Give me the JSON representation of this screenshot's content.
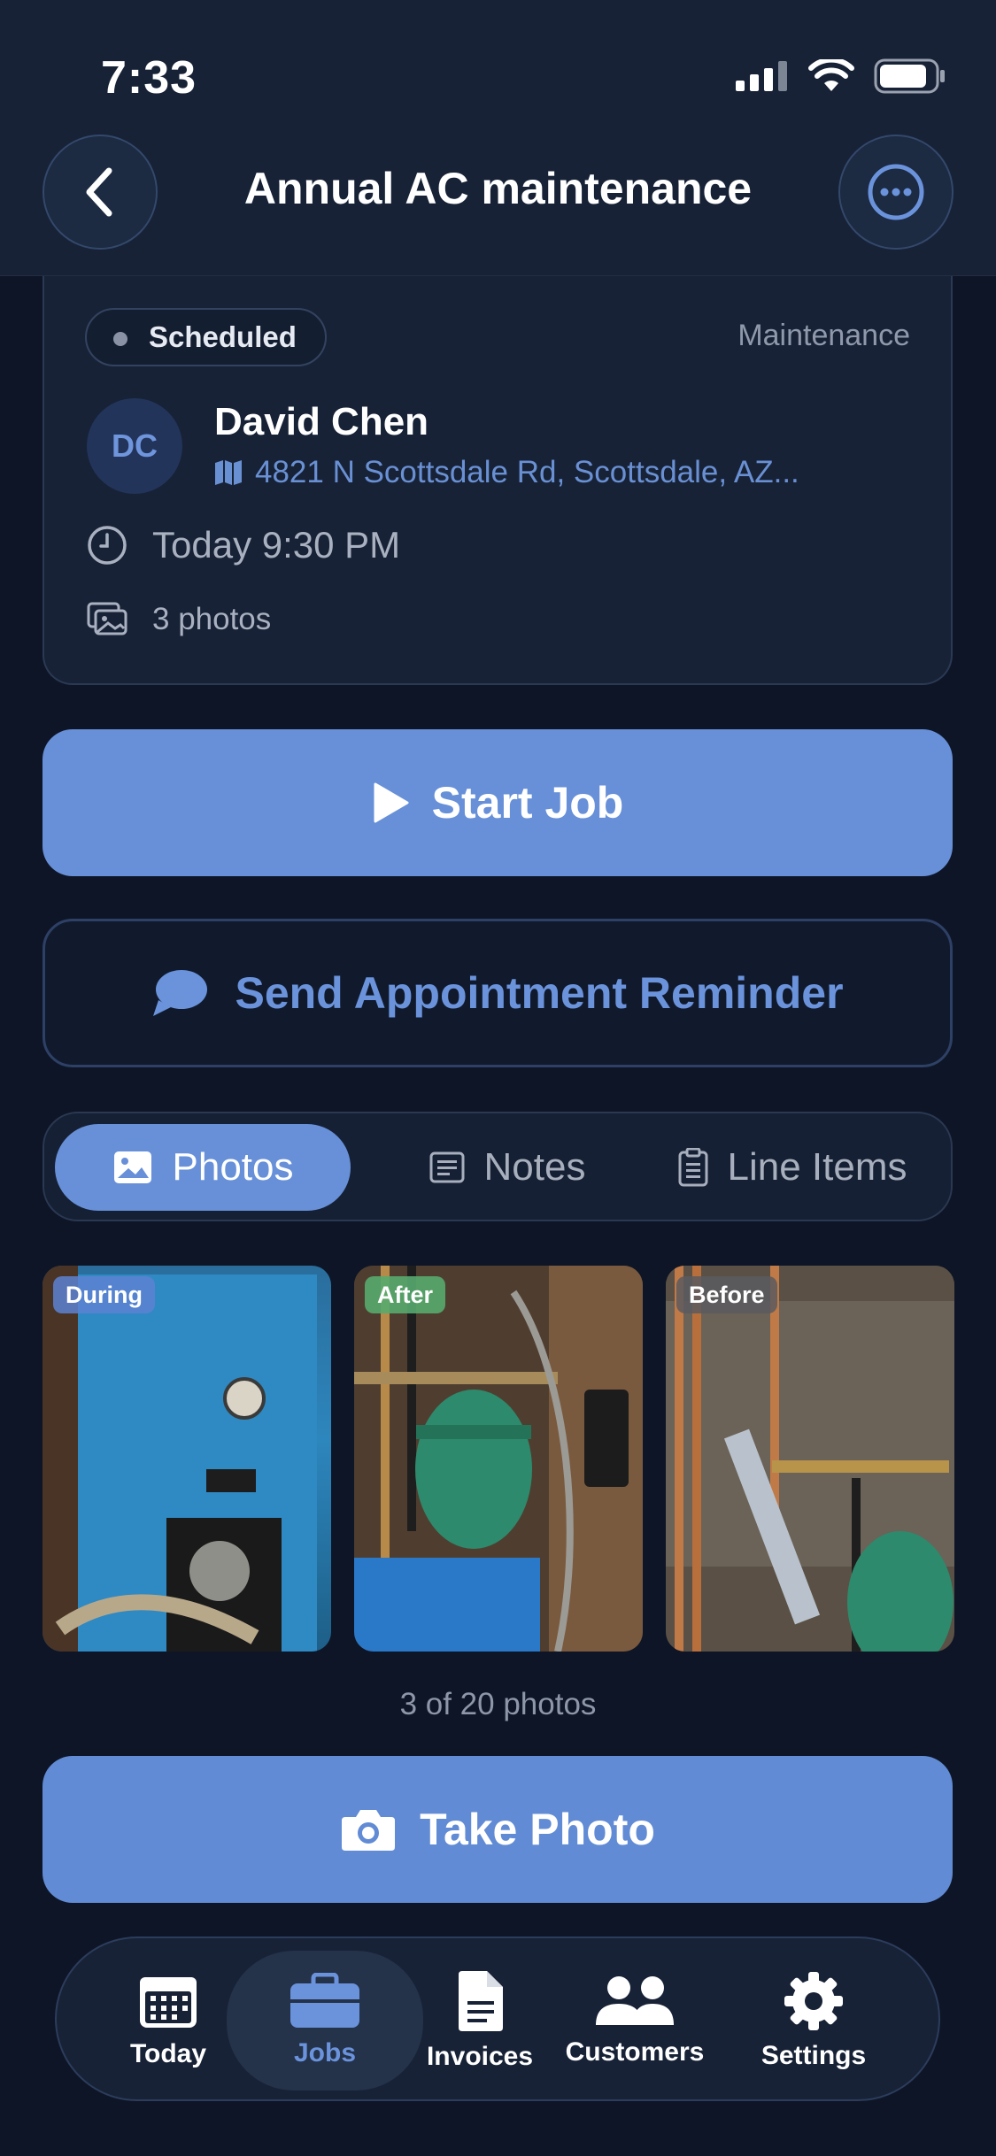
{
  "status_bar": {
    "time": "7:33"
  },
  "header": {
    "title": "Annual AC maintenance"
  },
  "job": {
    "status": "Scheduled",
    "category": "Maintenance",
    "customer": {
      "initials": "DC",
      "name": "David Chen",
      "address": "4821 N Scottsdale Rd, Scottsdale, AZ..."
    },
    "time": "Today 9:30 PM",
    "photos": "3 photos"
  },
  "actions": {
    "start_job": "Start Job",
    "send_reminder": "Send Appointment Reminder",
    "take_photo": "Take Photo"
  },
  "tabs": [
    {
      "label": "Photos",
      "active": true
    },
    {
      "label": "Notes",
      "active": false
    },
    {
      "label": "Line Items",
      "active": false
    }
  ],
  "gallery": {
    "photos": [
      {
        "tag": "During"
      },
      {
        "tag": "After"
      },
      {
        "tag": "Before"
      }
    ],
    "count": "3 of 20 photos"
  },
  "tabbar": {
    "items": [
      {
        "label": "Today",
        "active": false
      },
      {
        "label": "Jobs",
        "active": true
      },
      {
        "label": "Invoices",
        "active": false
      },
      {
        "label": "Customers",
        "active": false
      },
      {
        "label": "Settings",
        "active": false
      }
    ]
  },
  "colors": {
    "accent": "#6790d8",
    "background": "#0e1526",
    "card": "#172236",
    "link": "#6a90d4"
  }
}
